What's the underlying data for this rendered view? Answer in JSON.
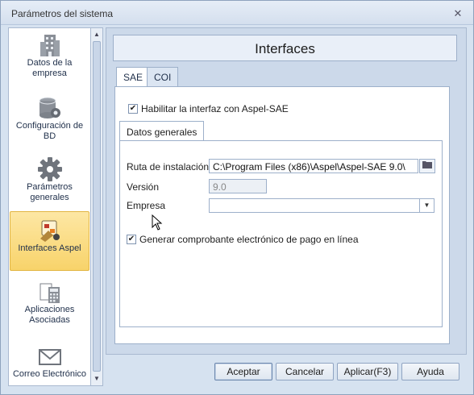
{
  "window": {
    "title": "Parámetros del sistema",
    "close_glyph": "✕"
  },
  "sidebar": {
    "items": [
      {
        "label": "Datos de la empresa",
        "icon": "building-icon"
      },
      {
        "label": "Configuración de BD",
        "icon": "database-gear-icon"
      },
      {
        "label": "Parámetros generales",
        "icon": "gear-icon"
      },
      {
        "label": "Interfaces Aspel",
        "icon": "interfaces-icon",
        "active": true
      },
      {
        "label": "Aplicaciones Asociadas",
        "icon": "calculator-icon"
      },
      {
        "label": "Correo Electrónico",
        "icon": "envelope-icon"
      }
    ]
  },
  "header": {
    "title": "Interfaces"
  },
  "tabs": [
    {
      "label": "SAE",
      "active": true
    },
    {
      "label": "COI",
      "active": false
    }
  ],
  "sae": {
    "enable_checkbox": {
      "label": "Habilitar la interfaz con Aspel-SAE",
      "checked": true
    },
    "inner_tab": "Datos generales",
    "fields": {
      "install_path": {
        "label": "Ruta de instalación",
        "value": "C:\\Program Files (x86)\\Aspel\\Aspel-SAE 9.0\\"
      },
      "version": {
        "label": "Versión",
        "value": "9.0"
      },
      "company": {
        "label": "Empresa",
        "value": ""
      }
    },
    "generate_checkbox": {
      "label": "Generar comprobante electrónico de pago en línea",
      "checked": true
    }
  },
  "buttons": {
    "accept": "Aceptar",
    "cancel": "Cancelar",
    "apply": "Aplicar(F3)",
    "help": "Ayuda"
  },
  "colors": {
    "active_item": "#f8d36a",
    "accent_border": "#9db0ca"
  }
}
